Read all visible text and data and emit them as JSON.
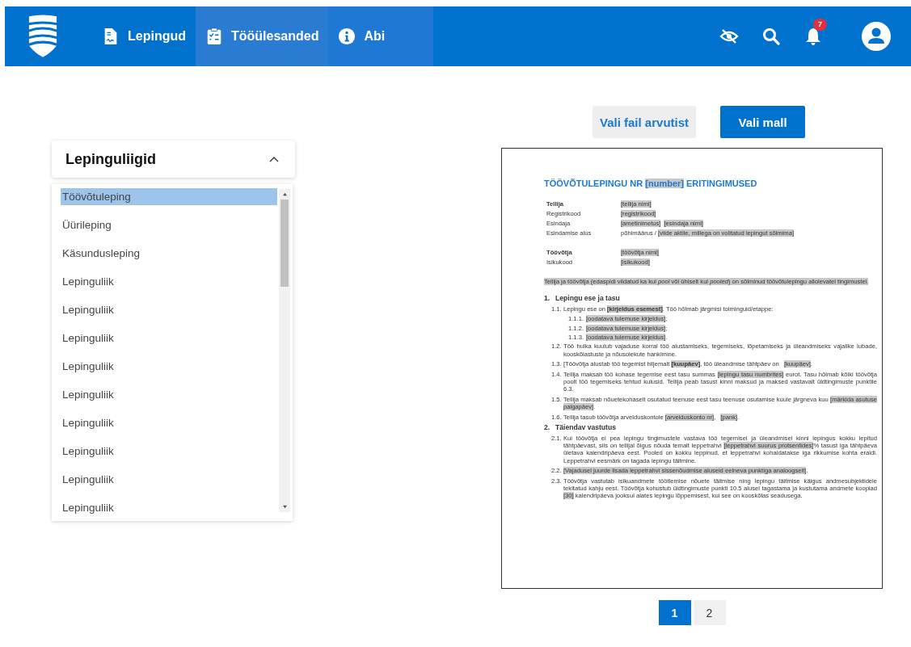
{
  "header": {
    "nav": [
      {
        "label": "Lepingud",
        "selected": false,
        "hover": false
      },
      {
        "label": "Tööülesanded",
        "selected": true,
        "hover": false
      },
      {
        "label": "Abi",
        "selected": false,
        "hover": true
      }
    ],
    "notifications": {
      "count": "7"
    }
  },
  "contract_types": {
    "title": "Lepinguliigid",
    "expanded": true,
    "items": [
      {
        "label": "Töövõtuleping",
        "selected": true
      },
      {
        "label": "Üürileping",
        "selected": false
      },
      {
        "label": "Käsundusleping",
        "selected": false
      },
      {
        "label": "Lepinguliik",
        "selected": false
      },
      {
        "label": "Lepinguliik",
        "selected": false
      },
      {
        "label": "Lepinguliik",
        "selected": false
      },
      {
        "label": "Lepinguliik",
        "selected": false
      },
      {
        "label": "Lepinguliik",
        "selected": false
      },
      {
        "label": "Lepinguliik",
        "selected": false
      },
      {
        "label": "Lepinguliik",
        "selected": false
      },
      {
        "label": "Lepinguliik",
        "selected": false
      },
      {
        "label": "Lepinguliik",
        "selected": false
      }
    ]
  },
  "actions": [
    {
      "label": "Vali fail arvutist",
      "kind": "secondary"
    },
    {
      "label": "Vali mall",
      "kind": "primary"
    }
  ],
  "document": {
    "title": [
      {
        "text": "TÖÖVÕTULEPINGU NR "
      },
      {
        "text": "[number]",
        "highlight": true
      },
      {
        "text": " ERITINGIMUSED"
      }
    ],
    "party_groups": [
      [
        {
          "label": "Tellija",
          "bold": true,
          "value": [
            {
              "text": "[tellija nimi]",
              "highlight": true
            }
          ]
        },
        {
          "label": "Registrikood",
          "bold": false,
          "value": [
            {
              "text": "[registrikood]",
              "highlight": true
            }
          ]
        },
        {
          "label": "Esindaja",
          "bold": false,
          "value": [
            {
              "text": "[ametinimetus]",
              "highlight": true
            },
            {
              "text": "[esindaja nimi]",
              "highlight": true
            }
          ]
        },
        {
          "label": "Esindamise alus",
          "bold": false,
          "value": [
            {
              "text": "põhimäärus / "
            },
            {
              "text": "[viide aktile, millega on volitatud lepingut sõlmima]",
              "highlight": true
            }
          ]
        }
      ],
      [
        {
          "label": "Töövõtja",
          "bold": true,
          "value": [
            {
              "text": "[töövõtja nimi]",
              "highlight": true
            }
          ]
        },
        {
          "label": "Isikukood",
          "bold": false,
          "value": [
            {
              "text": "[isikukood]",
              "highlight": true
            }
          ]
        }
      ]
    ],
    "intro": [
      {
        "text": "Tellija ja töövõtja (edaspidi viidatud ka kui *pool* või ühiselt kui *pooled*) on sõlminud töövõtulepingu allolevatel tingimustel.",
        "highlight": true
      }
    ],
    "sections": [
      {
        "number": "1.",
        "heading": "Lepingu ese ja tasu",
        "clauses": [
          {
            "number": "1.1.",
            "text": [
              {
                "text": "Lepingu ese on "
              },
              {
                "text": "**[kirjeldus esemest]**",
                "highlight": true
              },
              {
                "text": ". Töö hõlmab järgmisi toiminguid/etappe:"
              }
            ],
            "subclauses": [
              {
                "number": "1.1.1.",
                "text": [
                  {
                    "text": "[oodatava tulemuse kirjeldus]",
                    "highlight": true
                  },
                  {
                    "text": ";"
                  }
                ]
              },
              {
                "number": "1.1.2.",
                "text": [
                  {
                    "text": "[oodatava tulemuse kirjeldus]",
                    "highlight": true
                  },
                  {
                    "text": ";"
                  }
                ]
              },
              {
                "number": "1.1.3.",
                "text": [
                  {
                    "text": "[oodatava tulemuse kirjeldus]",
                    "highlight": true
                  },
                  {
                    "text": "."
                  }
                ]
              }
            ]
          },
          {
            "number": "1.2.",
            "text": [
              {
                "text": "Töö hulka kuulub vajaduse korral töö alustamiseks, tegemiseks, lõpetamiseks ja üleandmiseks vajalike lubade, kooskõlastuste ja nõusolekute hankimine."
              }
            ]
          },
          {
            "number": "1.3.",
            "text": [
              {
                "text": "[Töövõtja alustab töö tegemist hiljemalt "
              },
              {
                "text": "**[kuupäev]**",
                "highlight": true
              },
              {
                "text": ", töö üleandmise tähtpäev on "
              },
              {
                "text": "[kuupäev]",
                "highlight": true
              },
              {
                "text": "."
              }
            ]
          },
          {
            "number": "1.4.",
            "text": [
              {
                "text": "Tellija maksab töö kohase tegemise eest tasu summas "
              },
              {
                "text": "[lepingu tasu numbrites]",
                "highlight": true
              },
              {
                "text": " eurot. Tasu hõlmab kõiki töövõtja poolt töö tegemiseks tehtud kulusid. Tellija peab tasust kinni maksud ja maksed vastavalt üldtingimuste punktile 6.3."
              }
            ]
          },
          {
            "number": "1.5.",
            "text": [
              {
                "text": "Tellija maksab nõuetekohaselt osutatud teenuse eest tasu teenuse osutamise kuule järgneva kuu "
              },
              {
                "text": "[märkida asutuse palgapäev]",
                "highlight": true
              },
              {
                "text": "."
              }
            ]
          },
          {
            "number": "1.6.",
            "text": [
              {
                "text": "Tellija tasub töövõtja arvelduskontole "
              },
              {
                "text": "[arvelduskonto nr]",
                "highlight": true
              },
              {
                "text": ", "
              },
              {
                "text": "[pank]",
                "highlight": true
              },
              {
                "text": "."
              }
            ]
          }
        ]
      },
      {
        "number": "2.",
        "heading": "Täiendav vastutus",
        "clauses": [
          {
            "number": "2.1.",
            "text": [
              {
                "text": "Kui töövõtja ei pea lepingu tingimustele vastava töö tegemisel ja üleandmisel kinni lepingus kokku lepitud tähtpäevast, siis on tellijal õigus nõuda temalt leppetrahvi "
              },
              {
                "text": "[leppetrahvi suurus protsentides]",
                "highlight": true
              },
              {
                "text": "% tasust iga tähtpäeva ületava kalendripäeva eest. Pooled on kokku leppinud, et leppetrahvi kohaldatakse iga rikkumise kohta eraldi. Leppetrahvi eesmärk on tagada lepingu täitmine."
              }
            ]
          },
          {
            "number": "2.2.",
            "text": [
              {
                "text": "[Vajadusel juurde lisada leppetrahvi sissenõudmise aluseid eelneva punktiga analoogselt]",
                "highlight": true
              },
              {
                "text": "."
              }
            ]
          },
          {
            "number": "2.3.",
            "text": [
              {
                "text": "Töövõtja vastutab isikuandmete töötlemise nõuete täitmise ning lepingu täitmise käigus andmesubjektidele tekitatud kahju eest. Töövõtja kohustub üldtingimuste punkti 10.5 alusel tagastama ja kustutama andmete koopiad "
              },
              {
                "text": "[30]",
                "highlight": true
              },
              {
                "text": " kalendripäeva jooksul alates lepingu lõppemisest, kui see on kooskõlas seadusega."
              }
            ]
          }
        ]
      }
    ]
  },
  "pagination": [
    {
      "label": "1",
      "selected": true
    },
    {
      "label": "2",
      "selected": false
    }
  ]
}
